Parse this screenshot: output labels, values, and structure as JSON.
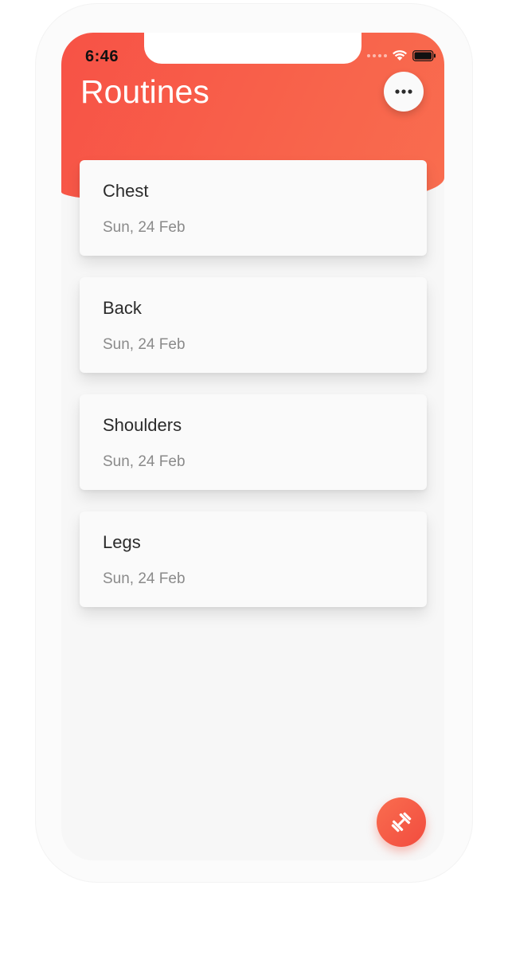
{
  "status_bar": {
    "time": "6:46",
    "icons": [
      "cellular-signal-icon",
      "wifi-icon",
      "battery-icon"
    ]
  },
  "header": {
    "title": "Routines",
    "more_icon": "more-horizontal-icon",
    "gradient_colors": [
      "#f75246",
      "#f96d4f"
    ]
  },
  "routines": [
    {
      "name": "Chest",
      "date": "Sun, 24 Feb"
    },
    {
      "name": "Back",
      "date": "Sun, 24 Feb"
    },
    {
      "name": "Shoulders",
      "date": "Sun, 24 Feb"
    },
    {
      "name": "Legs",
      "date": "Sun, 24 Feb"
    }
  ],
  "fab": {
    "icon": "dumbbell-icon",
    "color": "#f5553f"
  }
}
